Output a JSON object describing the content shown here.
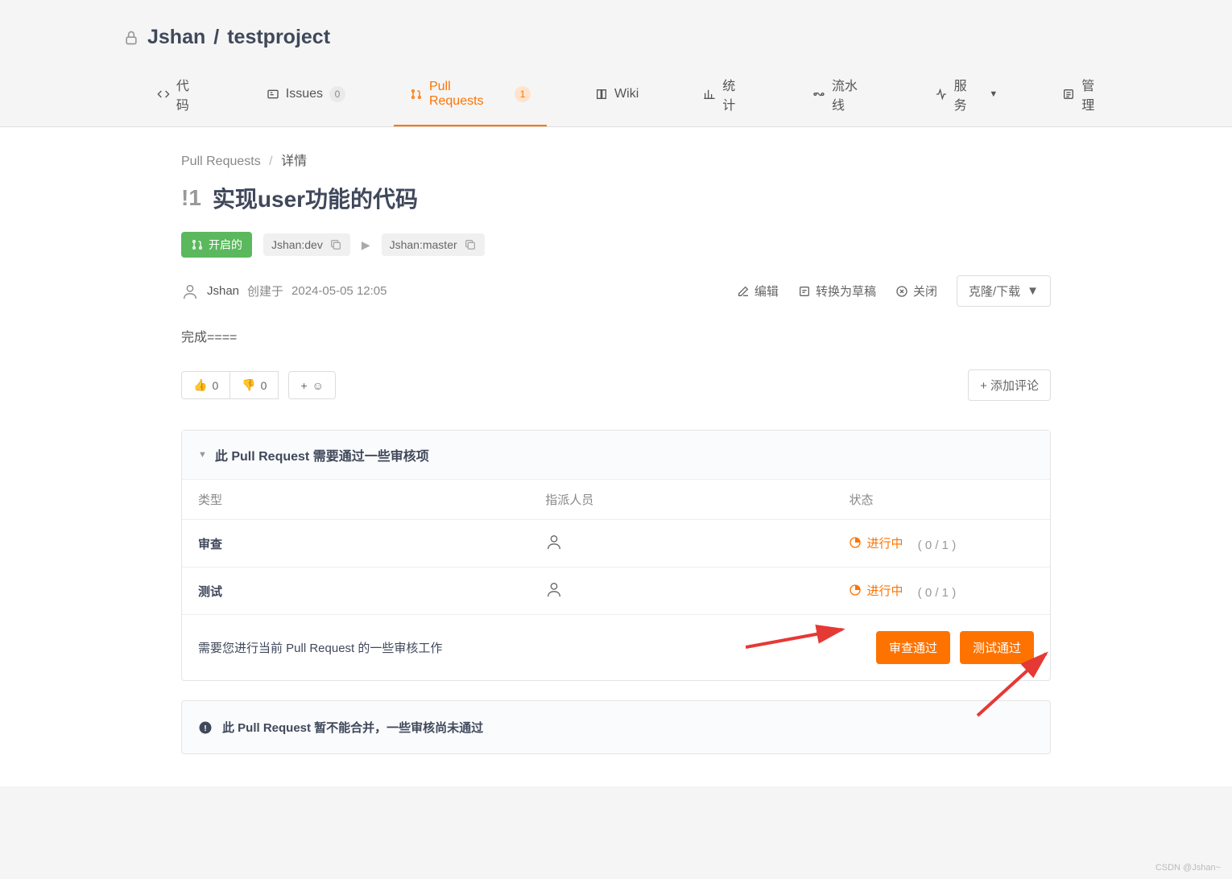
{
  "repo": {
    "owner": "Jshan",
    "sep": "/",
    "name": "testproject"
  },
  "tabs": {
    "code": "代码",
    "issues": "Issues",
    "issues_count": "0",
    "prs": "Pull Requests",
    "prs_count": "1",
    "wiki": "Wiki",
    "stats": "统计",
    "pipeline": "流水线",
    "service": "服务",
    "manage": "管理"
  },
  "breadcrumb": {
    "root": "Pull Requests",
    "current": "详情"
  },
  "pr": {
    "id": "!1",
    "title": "实现user功能的代码",
    "status": "开启的",
    "source": "Jshan:dev",
    "target": "Jshan:master",
    "author": "Jshan",
    "created_prefix": "创建于",
    "created_at": "2024-05-05 12:05",
    "description": "完成===="
  },
  "actions": {
    "edit": "编辑",
    "draft": "转换为草稿",
    "close": "关闭",
    "clone": "克隆/下载"
  },
  "reactions": {
    "thumbs_up": "0",
    "thumbs_down": "0",
    "add_emoji": "+",
    "add_comment": "+ 添加评论"
  },
  "review": {
    "header": "此 Pull Request 需要通过一些审核项",
    "col_type": "类型",
    "col_assignee": "指派人员",
    "col_status": "状态",
    "rows": [
      {
        "type": "审查",
        "status": "进行中",
        "count": "( 0 / 1 )"
      },
      {
        "type": "测试",
        "status": "进行中",
        "count": "( 0 / 1 )"
      }
    ],
    "footer_text": "需要您进行当前 Pull Request 的一些审核工作",
    "btn_review": "审查通过",
    "btn_test": "测试通过"
  },
  "warning": "此 Pull Request 暂不能合并，一些审核尚未通过",
  "watermark": "CSDN @Jshan~"
}
